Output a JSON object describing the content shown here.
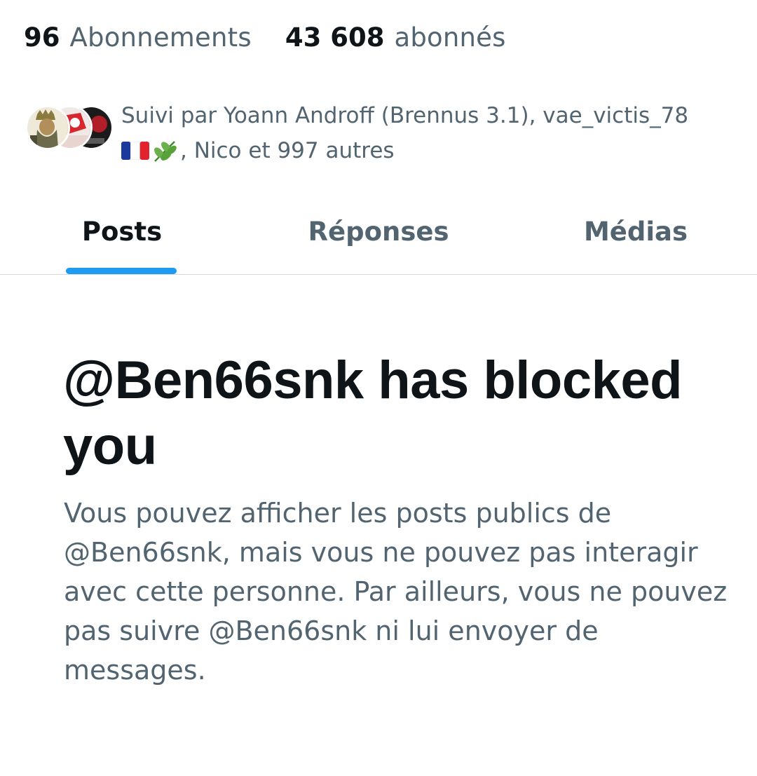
{
  "stats": {
    "following_count": "96",
    "following_label": "Abonnements",
    "followers_count": "43 608",
    "followers_label": "abonnés"
  },
  "followed_by": {
    "text_part1": "Suivi par Yoann Androff (Brennus 3.1), vae_victis_78",
    "text_part2": ", Nico et 997 autres",
    "emojis": [
      "french-flag-icon",
      "herb-icon"
    ]
  },
  "tabs": [
    {
      "label": "Posts",
      "selected": true
    },
    {
      "label": "Réponses",
      "selected": false
    },
    {
      "label": "Médias",
      "selected": false
    }
  ],
  "blocked": {
    "title": "@Ben66snk has blocked you",
    "description": "Vous pouvez afficher les posts publics de @Ben66snk, mais vous ne pouvez pas interagir avec cette personne. Par ailleurs, vous ne pouvez pas suivre @Ben66snk ni lui envoyer de messages."
  },
  "colors": {
    "text_primary": "#0f1419",
    "text_secondary": "#536471",
    "accent": "#1d9bf0",
    "divider": "#cfd9de",
    "background": "#ffffff"
  }
}
